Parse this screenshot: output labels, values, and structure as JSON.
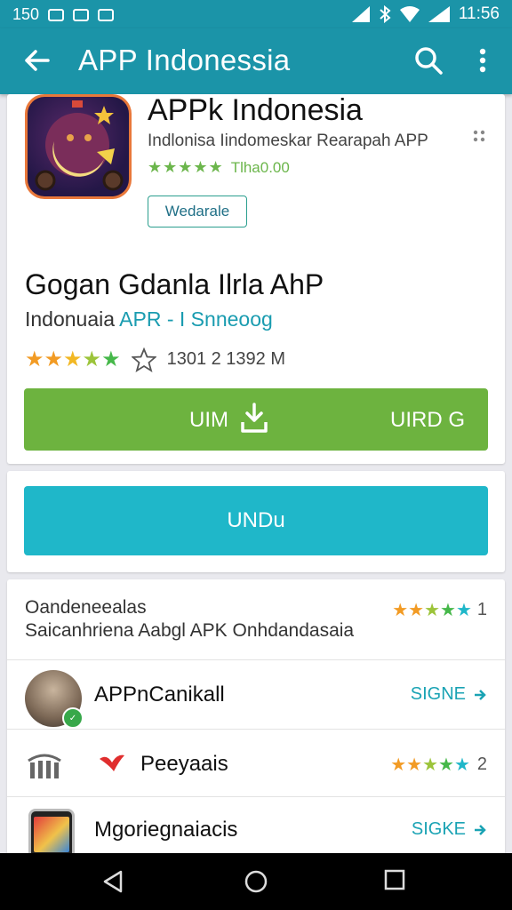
{
  "statusbar": {
    "time": "11:56",
    "left_text": "150",
    "left_icons": [
      "image-icon",
      "sim-icon",
      "photo-icon"
    ],
    "right_icons": [
      "signal-icon",
      "bluetooth-icon",
      "wifi-icon",
      "battery-icon"
    ]
  },
  "appbar": {
    "title": "APP Indonessia",
    "icons": [
      "back-arrow-icon",
      "search-icon",
      "more-vert-icon"
    ]
  },
  "app": {
    "title": "APPk Indonesia",
    "subtitle": "Indlonisa Iindomeskar Rearapah APP",
    "rating_stars": "★★★★★",
    "rating_text": "Tlha0.00",
    "tag_button": "Wedarale"
  },
  "detail": {
    "heading": "Gogan Gdanla Ilrla AhP",
    "sub_prefix": "Indonuaia ",
    "sub_accent": "APR - I Snneoog",
    "rating_text": "1301 2 1392 M",
    "install_left": "UIM",
    "install_right": "UIRD G"
  },
  "secondary_button": "UNDu",
  "list": {
    "title": "Oandeneealas",
    "subtitle": "Saicanhriena Aabgl APK Onhdandasaia",
    "header_rating": "1",
    "items": [
      {
        "name": "APPnCanikall",
        "action": "SIGNE",
        "icon": "avatar-icon"
      },
      {
        "name": "Peeyaais",
        "rating": "2",
        "icon": "bird-icon"
      },
      {
        "name": "Mgoriegnaiacis",
        "action": "SIGKE",
        "icon": "phone-app-icon"
      }
    ]
  },
  "colors": {
    "primary": "#1b94a8",
    "green": "#6db33f",
    "teal": "#1fb7c9",
    "star_orange": "#f29b24",
    "star_green": "#46b84a",
    "star_teal": "#1fb7c9"
  },
  "navbar": {
    "icons": [
      "back-triangle-icon",
      "home-circle-icon",
      "recents-square-icon"
    ]
  }
}
